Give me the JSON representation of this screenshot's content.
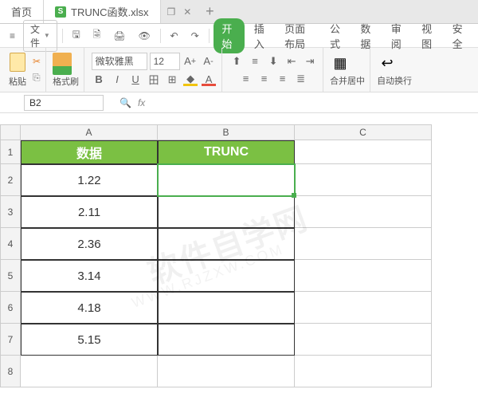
{
  "tabs": {
    "home": "首页",
    "filename": "TRUNC函数.xlsx"
  },
  "qa": {
    "file": "文件"
  },
  "menu": {
    "start": "开始",
    "insert": "插入",
    "layout": "页面布局",
    "formula": "公式",
    "data": "数据",
    "review": "审阅",
    "view": "视图",
    "safe": "安全"
  },
  "ribbon": {
    "paste": "粘贴",
    "format_painter": "格式刷",
    "font_name": "微软雅黑",
    "font_size": "12",
    "merge": "合并居中",
    "wrap": "自动换行"
  },
  "namebox": "B2",
  "chart_data": {
    "type": "table",
    "columns": [
      "A",
      "B",
      "C"
    ],
    "headers": {
      "A": "数据",
      "B": "TRUNC"
    },
    "rows": [
      {
        "A": "1.22",
        "B": ""
      },
      {
        "A": "2.11",
        "B": ""
      },
      {
        "A": "2.36",
        "B": ""
      },
      {
        "A": "3.14",
        "B": ""
      },
      {
        "A": "4.18",
        "B": ""
      },
      {
        "A": "5.15",
        "B": ""
      }
    ],
    "selected_cell": "B2"
  }
}
